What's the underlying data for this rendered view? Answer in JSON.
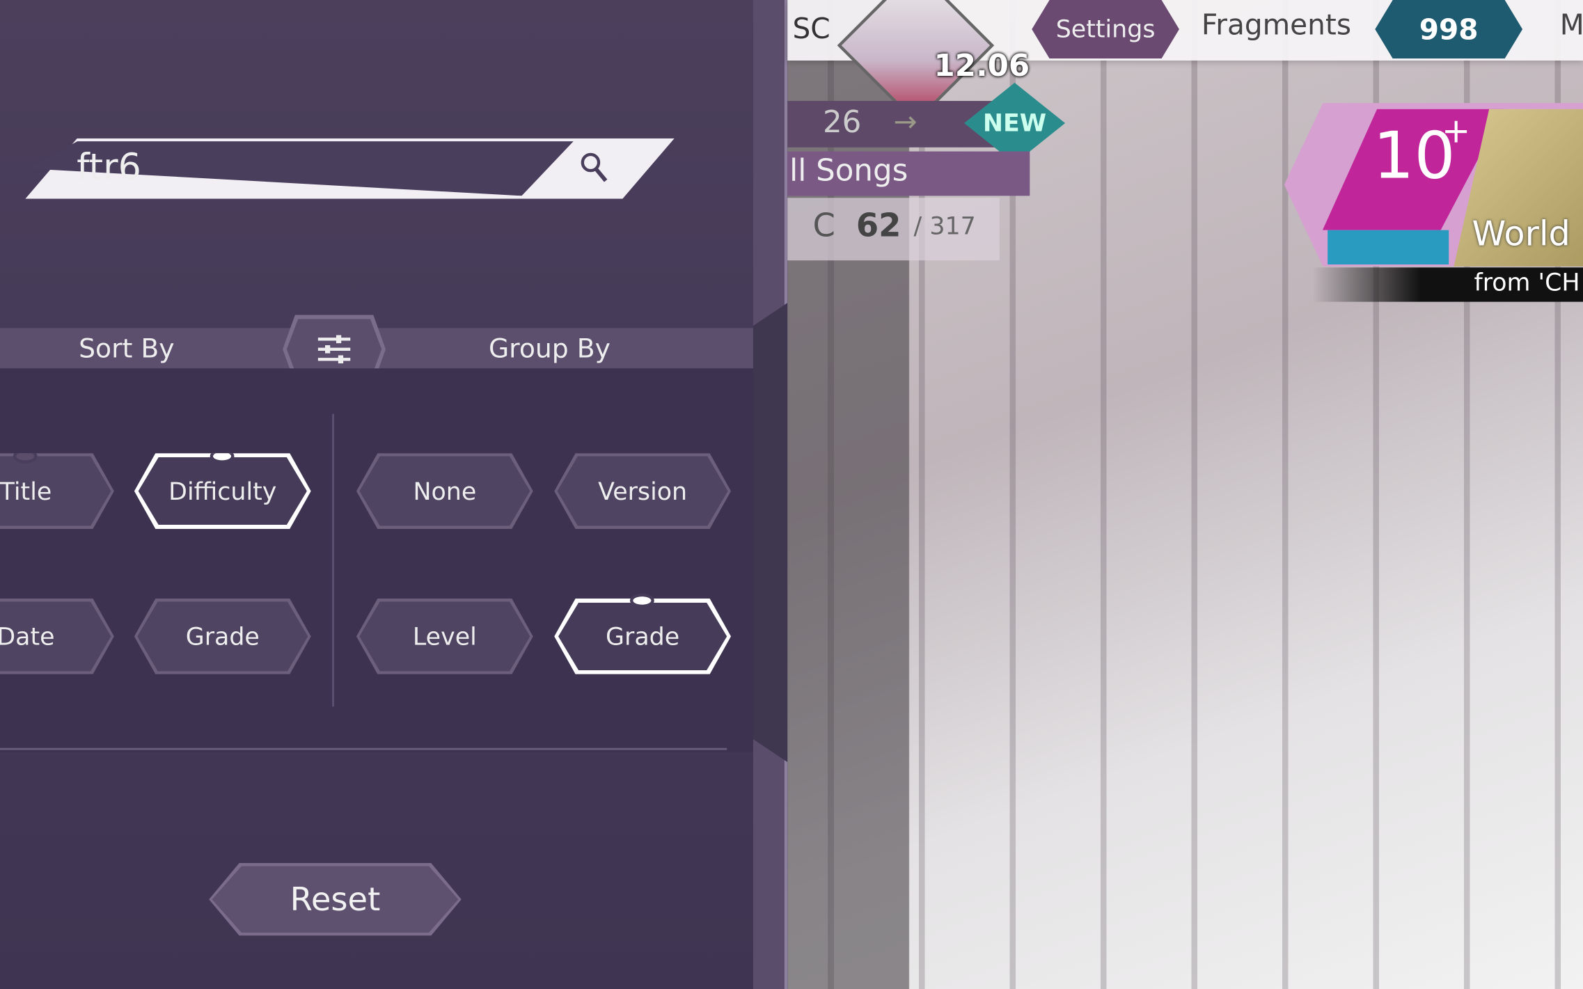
{
  "search": {
    "value": "ftr6",
    "icon": "search-icon"
  },
  "sort": {
    "label": "Sort By",
    "options": [
      "Title",
      "Difficulty",
      "Date",
      "Grade"
    ],
    "selected": "Difficulty"
  },
  "group": {
    "label": "Group By",
    "options": [
      "None",
      "Version",
      "Level",
      "Grade"
    ],
    "selected": "Grade"
  },
  "filter_icon": "sliders-icon",
  "reset_label": "Reset",
  "topbar": {
    "left_text": "SC",
    "potential": "12.06",
    "settings": "Settings",
    "fragments_label": "Fragments",
    "fragments_value": "998",
    "right_text": "M"
  },
  "info": {
    "count": "26",
    "arrow": "→",
    "new_badge": "NEW",
    "category": "ll Songs",
    "grade": "C",
    "cleared": "62",
    "total": "/ 317"
  },
  "song": {
    "level": "10",
    "level_plus": "+",
    "title": "World",
    "source": "from 'CH"
  },
  "colors": {
    "panel": "#4a3e5d",
    "fragments": "#1e5a70",
    "level": "#c0269a",
    "new": "#2a8c8c"
  }
}
